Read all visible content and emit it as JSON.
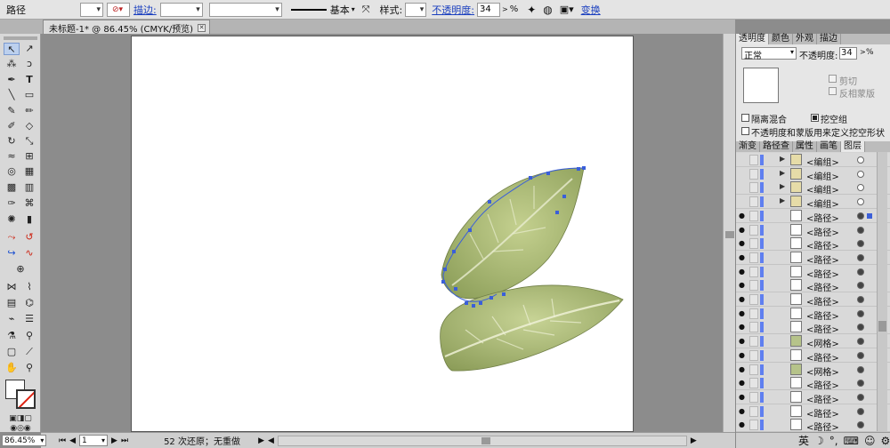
{
  "control_bar": {
    "object_type": "路径",
    "stroke_label": "描边:",
    "stroke_style": "基本",
    "style_label": "样式:",
    "opacity_label": "不透明度:",
    "opacity_value": "34",
    "opacity_unit": "%",
    "transform_label": "变换"
  },
  "document": {
    "tab_title": "未标题-1* @ 86.45% (CMYK/预览)"
  },
  "status_bar": {
    "zoom": "86.45%",
    "artboard_number": "1",
    "history_text": "52 次还原；无重做"
  },
  "transparency_panel": {
    "tabs": [
      "透明度",
      "颜色",
      "外观",
      "描边"
    ],
    "blend_mode": "正常",
    "opacity_label": "不透明度:",
    "opacity_value": "34",
    "opacity_unit": "%",
    "clip_label": "剪切",
    "invert_mask_label": "反相蒙版",
    "isolate_blend_label": "隔离混合",
    "knockout_group_label": "挖空组",
    "opacity_mask_label": "不透明度和蒙版用来定义挖空形状"
  },
  "layers_panel": {
    "tabs": [
      "渐变",
      "路径查",
      "属性",
      "画笔",
      "图层"
    ],
    "rows": [
      {
        "name": "<编组>",
        "expandable": true
      },
      {
        "name": "<编组>",
        "expandable": true
      },
      {
        "name": "<编组>",
        "expandable": true
      },
      {
        "name": "<编组>",
        "expandable": true
      },
      {
        "name": "<路径>",
        "selected": true
      },
      {
        "name": "<路径>"
      },
      {
        "name": "<路径>"
      },
      {
        "name": "<路径>"
      },
      {
        "name": "<路径>"
      },
      {
        "name": "<路径>"
      },
      {
        "name": "<路径>"
      },
      {
        "name": "<路径>"
      },
      {
        "name": "<路径>"
      },
      {
        "name": "<网格>"
      },
      {
        "name": "<路径>"
      },
      {
        "name": "<网格>"
      },
      {
        "name": "<路径>"
      },
      {
        "name": "<路径>"
      },
      {
        "name": "<路径>"
      },
      {
        "name": "<路径>"
      }
    ],
    "ime_text": "英"
  },
  "colors": {
    "leaf_fill": "#a9b97a",
    "leaf_dark": "#8e9f60",
    "selection_blue": "#3a5fd9",
    "link_blue": "#1a3fbf"
  }
}
